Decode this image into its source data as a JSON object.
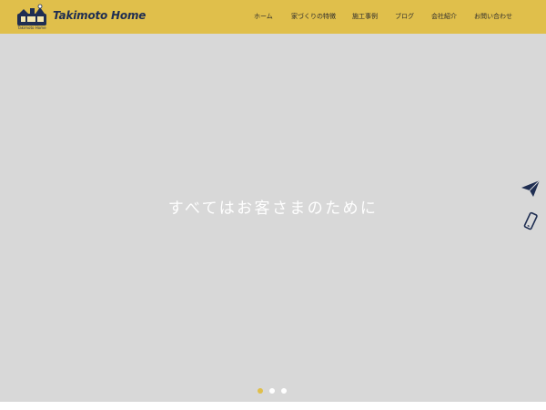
{
  "header": {
    "logo_text": "Takimoto Home",
    "logo_subtext": "Takimoto Home",
    "nav": [
      {
        "label": "ホーム"
      },
      {
        "label": "家づくりの特徴"
      },
      {
        "label": "施工事例"
      },
      {
        "label": "ブログ"
      },
      {
        "label": "会社紹介"
      },
      {
        "label": "お問い合わせ"
      }
    ]
  },
  "hero": {
    "title": "すべてはお客さまのために",
    "slides_total": 3,
    "active_slide": 1
  },
  "side_actions": [
    {
      "icon": "paper-plane-icon"
    },
    {
      "icon": "smartphone-icon"
    }
  ],
  "colors": {
    "header_bg": "#e0bf4b",
    "brand_navy": "#1f2e52",
    "hero_bg": "#d8d8d8",
    "dot_active": "#e0bf4b"
  }
}
